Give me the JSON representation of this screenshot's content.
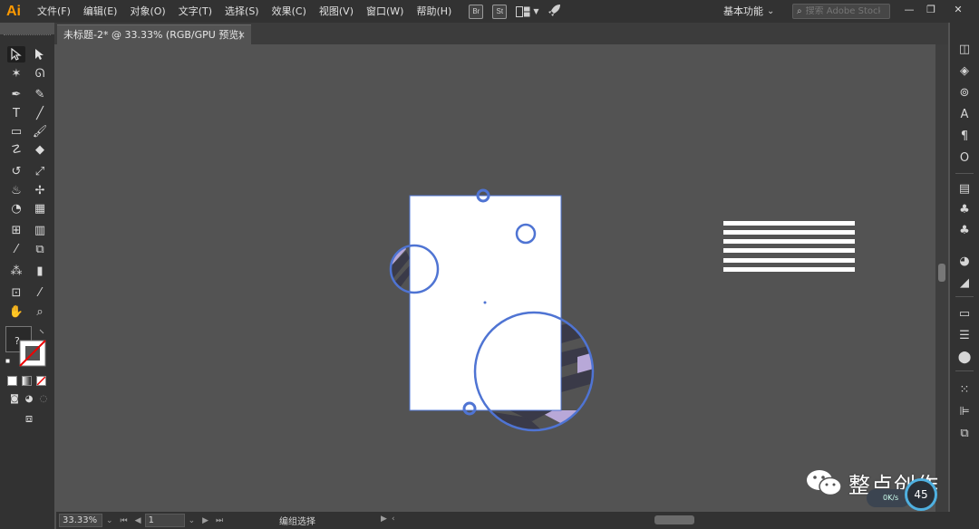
{
  "app": {
    "logo": "Ai",
    "menu": [
      {
        "label": "文件(F)"
      },
      {
        "label": "编辑(E)"
      },
      {
        "label": "对象(O)"
      },
      {
        "label": "文字(T)"
      },
      {
        "label": "选择(S)"
      },
      {
        "label": "效果(C)"
      },
      {
        "label": "视图(V)"
      },
      {
        "label": "窗口(W)"
      },
      {
        "label": "帮助(H)"
      }
    ],
    "bridge_icon": "Br",
    "stock_icon": "St",
    "workspace": "基本功能",
    "search_placeholder": "搜索 Adobe Stock",
    "window_buttons": [
      "—",
      "❐",
      "✕"
    ]
  },
  "document": {
    "tab_title": "未标题-2* @ 33.33% (RGB/GPU 预览)",
    "tab_close": "×"
  },
  "statusbar": {
    "zoom": "33.33%",
    "page": "1",
    "status_text": "编组选择"
  },
  "watermark": {
    "text": "整点创作",
    "net_speed": "0K/s",
    "net_value": "45"
  },
  "colors": {
    "selection": "#4f74d3",
    "artboard": "#ffffff",
    "stripe_dark": "#3a3a48",
    "stripe_light": "#b8a8d8",
    "canvas_bg": "#535353",
    "chrome": "#323232",
    "ai_logo": "#ff9a00"
  }
}
